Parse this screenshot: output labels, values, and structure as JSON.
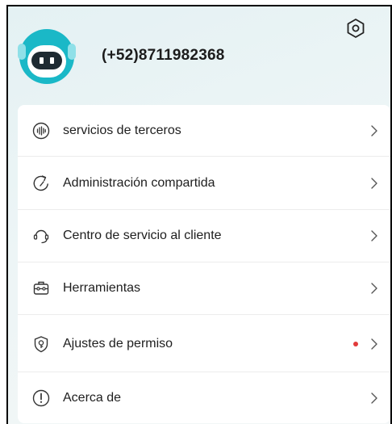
{
  "profile": {
    "phone": "(+52)8711982368"
  },
  "menu": {
    "items": [
      {
        "label": "servicios de terceros",
        "icon": "third-party-services-icon"
      },
      {
        "label": "Administración compartida",
        "icon": "shared-management-icon"
      },
      {
        "label": "Centro de servicio al cliente",
        "icon": "headset-icon"
      },
      {
        "label": "Herramientas",
        "icon": "toolbox-icon"
      },
      {
        "label": "Ajustes de permiso",
        "icon": "permission-shield-icon",
        "badge": "red-dot"
      },
      {
        "label": "Acerca de",
        "icon": "info-icon"
      }
    ]
  },
  "colors": {
    "accent": "#1ab8c7",
    "badge": "#e23b3b"
  }
}
